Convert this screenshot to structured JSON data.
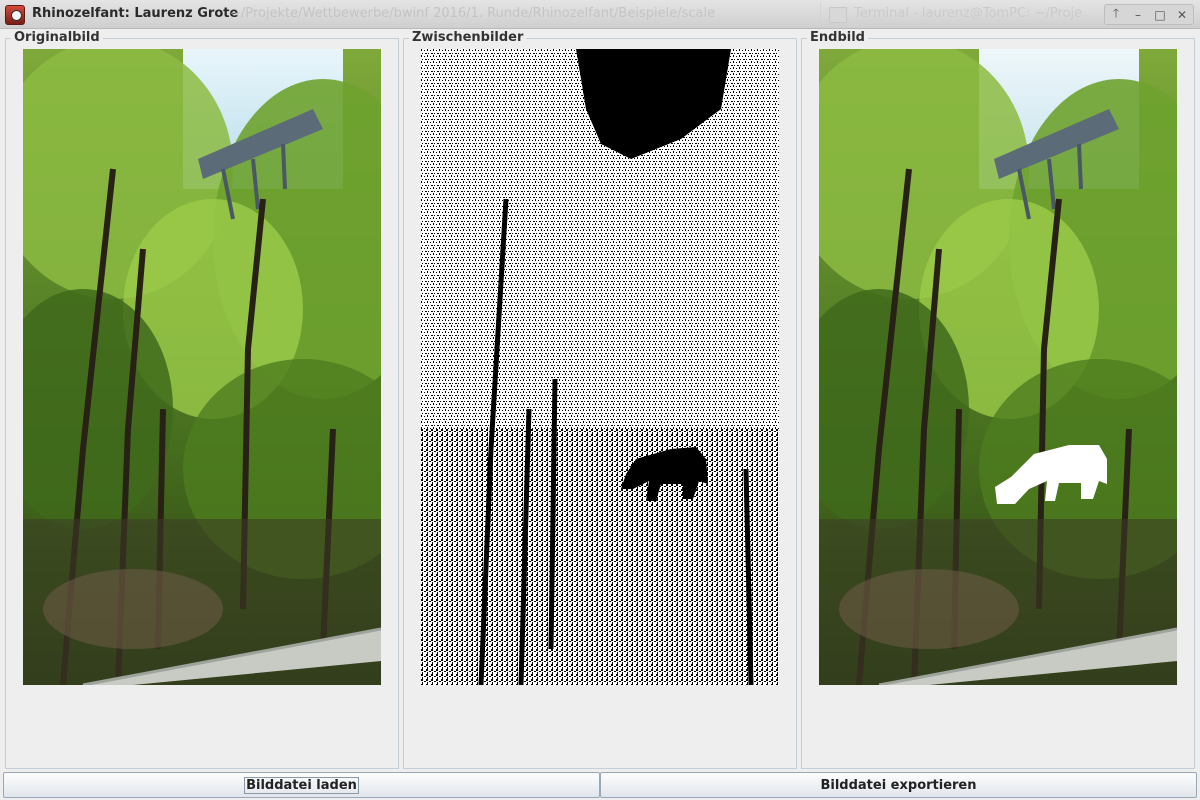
{
  "window": {
    "title": "Rhinozelfant: Laurenz Grote",
    "background_title": "~/Projekte/Wettbewerbe/bwinf 2016/1. Runde/Rhinozelfant/Beispiele/scale",
    "background_task_title": "Terminal - laurenz@TomPC: ~/Proje",
    "controls": {
      "up_icon": "🡑",
      "minimize_icon": "–",
      "maximize_icon": "□",
      "close_icon": "✕"
    }
  },
  "panels": {
    "original": {
      "label": "Originalbild"
    },
    "intermediate": {
      "label": "Zwischenbilder"
    },
    "final": {
      "label": "Endbild"
    }
  },
  "buttons": {
    "load": "Bilddatei laden",
    "export": "Bilddatei exportieren"
  },
  "colors": {
    "panel_border": "#c4ced9",
    "background": "#eeeeee",
    "foliage": "#5b8a24",
    "sky": "#dbeef7"
  }
}
